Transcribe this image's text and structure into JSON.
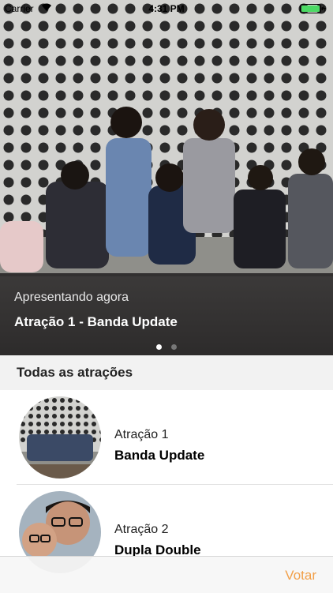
{
  "status_bar": {
    "carrier": "Carrier",
    "time": "4:31 PM"
  },
  "hero": {
    "kicker": "Apresentando agora",
    "title": "Atração 1 - Banda Update",
    "page_count": 2,
    "active_page": 1
  },
  "section": {
    "title": "Todas as atrações"
  },
  "attractions": [
    {
      "label": "Atração 1",
      "name": "Banda Update"
    },
    {
      "label": "Atração 2",
      "name": "Dupla Double"
    }
  ],
  "tabbar": {
    "vote_label": "Votar"
  },
  "colors": {
    "accent": "#f2a04a",
    "overlay": "#232121",
    "section_bg": "#f2f2f2"
  }
}
